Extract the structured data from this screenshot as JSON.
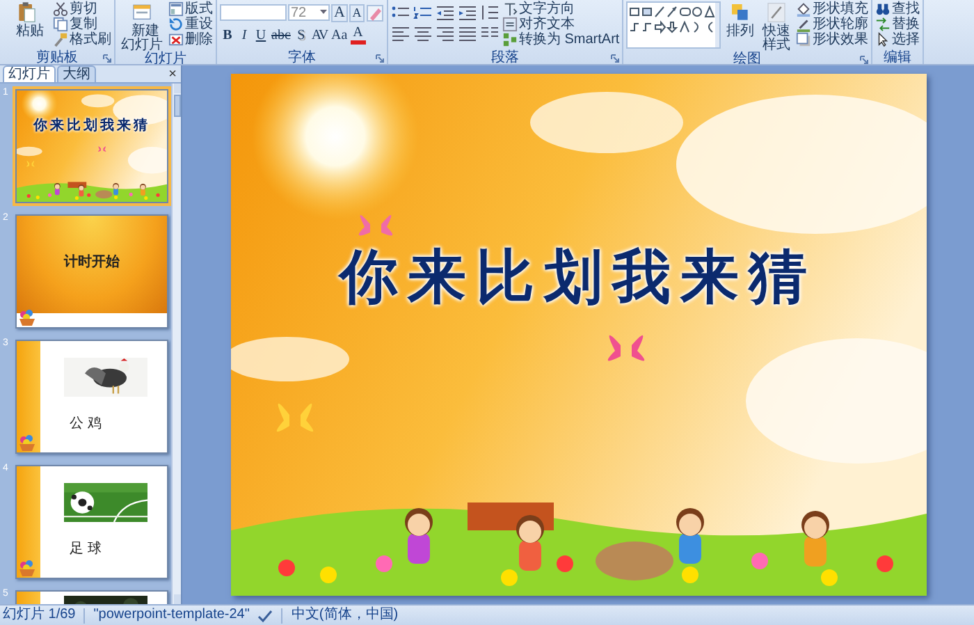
{
  "ribbon": {
    "groups": [
      {
        "label": "剪贴板",
        "kind": "clipboard",
        "large": "粘贴",
        "small": [
          "剪切",
          "复制",
          "格式刷"
        ]
      },
      {
        "label": "幻灯片",
        "kind": "slides",
        "large": "新建幻灯片",
        "small": [
          "版式",
          "重设",
          "删除"
        ]
      },
      {
        "label": "字体",
        "kind": "font",
        "size": "72",
        "size_buttons": [
          "A",
          "A"
        ],
        "buttons": [
          "B",
          "I",
          "U",
          "abc",
          "S",
          "AV",
          "Aa",
          "A"
        ]
      },
      {
        "label": "段落",
        "kind": "paragraph",
        "small": [
          "文字方向",
          "对齐文本",
          "转换为 SmartArt"
        ]
      },
      {
        "label": "绘图",
        "kind": "drawing",
        "large": "排列",
        "style": "快速样式",
        "small": [
          "形状填充",
          "形状轮廓",
          "形状效果"
        ]
      },
      {
        "label": "编辑",
        "kind": "editing",
        "small": [
          "查找",
          "替换",
          "选择"
        ]
      }
    ]
  },
  "sidebar": {
    "tabs": [
      {
        "label": "幻灯片",
        "selected": true
      },
      {
        "label": "大纲",
        "selected": false
      }
    ],
    "close": "×",
    "slides": [
      {
        "number": "1",
        "kind": "title",
        "selected": true,
        "title": "你来比划我来猜"
      },
      {
        "number": "2",
        "kind": "text",
        "selected": false,
        "title": "计时开始"
      },
      {
        "number": "3",
        "selected": false,
        "caption": "公 鸡"
      },
      {
        "number": "4",
        "selected": false,
        "caption": "足 球"
      },
      {
        "number": "5",
        "selected": false
      }
    ]
  },
  "slide": {
    "title": "你来比划我来猜"
  },
  "status_bar": {
    "slide_count": "幻灯片 1/69",
    "theme": "\"powerpoint-template-24\"",
    "language": "中文(简体，中国)"
  }
}
